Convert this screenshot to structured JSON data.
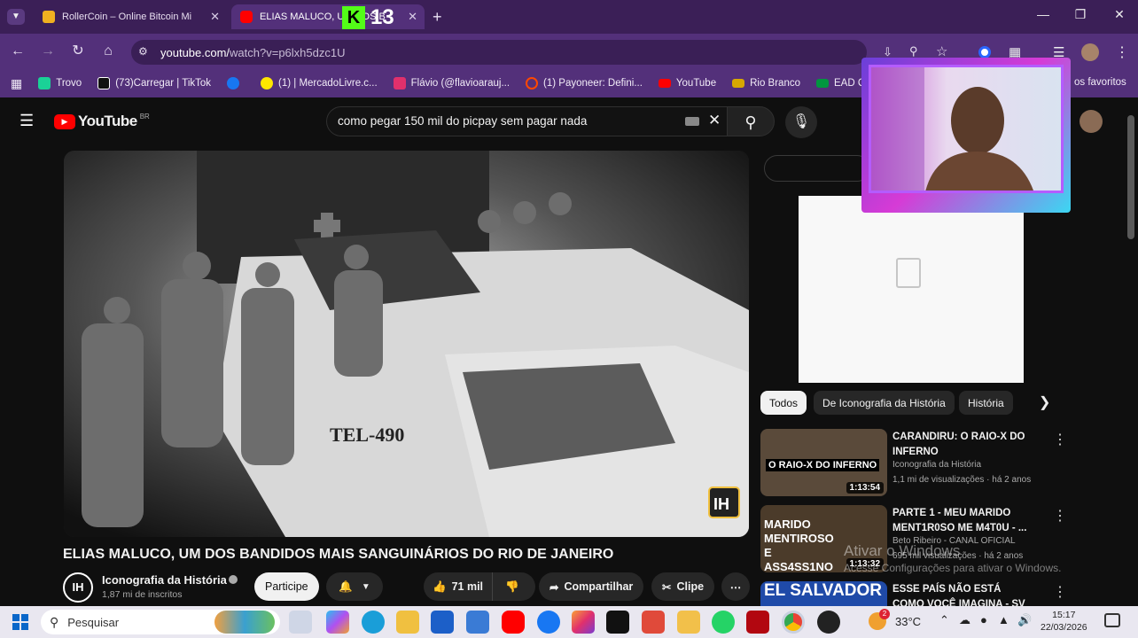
{
  "browser": {
    "tabs": [
      {
        "label": "RollerCoin – Online Bitcoin Mi",
        "active": false
      },
      {
        "label": "ELIAS MALUCO, UM DOS B",
        "active": true
      }
    ],
    "overlay_badge": "13",
    "url_prefix": "youtube.com/",
    "url_rest": "watch?v=p6lxh5dzc1U",
    "bookmarks": [
      {
        "label": "Trovo",
        "color": "#1ad197"
      },
      {
        "label": "(73)Carregar | TikTok",
        "color": "#111111"
      },
      {
        "label": "",
        "color": "#1877f2"
      },
      {
        "label": "(1) | MercadoLivre.c...",
        "color": "#ffe600"
      },
      {
        "label": "Flávio (@flavioarauj...",
        "color": "#e1306c"
      },
      {
        "label": "(1) Payoneer: Defini...",
        "color": "#ff4800"
      },
      {
        "label": "YouTube",
        "color": "#ff0000"
      },
      {
        "label": "Rio Branco",
        "color": "#d7a800"
      },
      {
        "label": "EAD Cursos",
        "color": "#00963f"
      }
    ],
    "bookmarks_more": "os favoritos"
  },
  "youtube": {
    "logo_text": "YouTube",
    "logo_region": "BR",
    "search_value": "como pegar 150 mil do picpay sem pagar nada",
    "video_badge": "IH",
    "video_plate": "TEL-490",
    "video_title": "ELIAS MALUCO, UM DOS BANDIDOS MAIS SANGUINÁRIOS DO RIO DE JANEIRO",
    "channel_name": "Iconografia da História",
    "channel_subs": "1,87 mi de inscritos",
    "channel_avatar": "IH",
    "subscribe_label": "Participe",
    "likes": "71 mil",
    "share_label": "Compartilhar",
    "clip_label": "Clipe",
    "chips": [
      "Todos",
      "De Iconografia da História",
      "História"
    ],
    "recommendations": [
      {
        "title": "CARANDIRU: O RAIO-X DO INFERNO",
        "channel": "Iconografia da História",
        "meta": "1,1 mi de visualizações · há 2 anos",
        "duration": "1:13:54",
        "thumb_text": "O RAIO-X DO INFERNO",
        "thumb_color": "#5a4a3a"
      },
      {
        "title": "PARTE 1 - MEU MARIDO MENT1R0SO ME M4T0U - ...",
        "channel": "Beto Ribeiro - CANAL OFICIAL",
        "meta": "695 mil visualizações · há 2 anos",
        "duration": "1:13:32",
        "thumb_text": "MARIDO MENTIROSO E ASS4SS1NO",
        "thumb_color": "#4b3b2a"
      },
      {
        "title": "ESSE PAÍS NÃO ESTÁ COMO VOCÊ IMAGINA - SV",
        "channel": "",
        "meta": "",
        "duration": "",
        "thumb_text": "EL SALVADOR",
        "thumb_color": "#1f4aa8"
      }
    ]
  },
  "watermark": {
    "line1": "Ativar o Windows",
    "line2": "Acesse Configurações para ativar o Windows."
  },
  "taskbar": {
    "search_placeholder": "Pesquisar",
    "temperature": "33°C",
    "time": "15:17",
    "date": "22/03/2026",
    "weather_badge": "2"
  }
}
